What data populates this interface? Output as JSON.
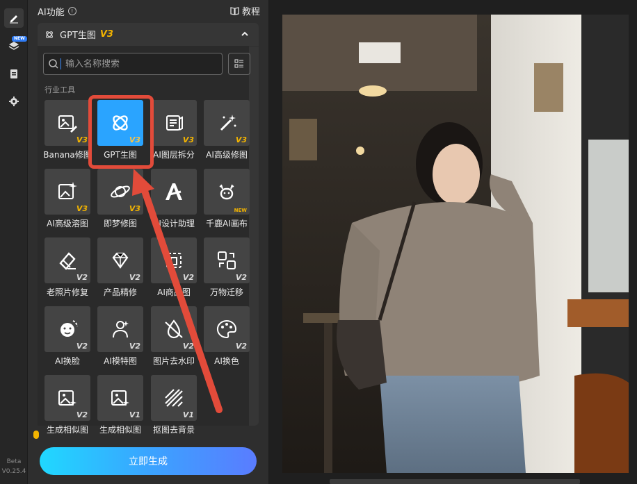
{
  "rail": {
    "new_tag": "NEW",
    "beta": "Beta",
    "version": "V0.25.4"
  },
  "panel": {
    "title": "AI功能",
    "info_symbol": "!",
    "tutorial": "教程",
    "section": {
      "title": "GPT生图",
      "version": "V3"
    },
    "search": {
      "placeholder": "输入名称搜索"
    },
    "category": "行业工具",
    "tools": [
      {
        "label": "Banana修图",
        "version": "V3",
        "icon": "image-edit-icon"
      },
      {
        "label": "GPT生图",
        "version": "V3",
        "icon": "gpt-logo-icon",
        "selected": true
      },
      {
        "label": "AI图层拆分",
        "version": "V3",
        "icon": "layer-split-icon"
      },
      {
        "label": "AI高级修图",
        "version": "V3",
        "icon": "magic-wand-icon"
      },
      {
        "label": "AI高级溶图",
        "version": "V3",
        "icon": "image-sparkle-icon"
      },
      {
        "label": "即梦修图",
        "version": "V3",
        "icon": "planet-icon"
      },
      {
        "label": "AI设计助理",
        "version": "",
        "icon": "ai-assistant-icon"
      },
      {
        "label": "千鹿AI画布",
        "version": "NEW",
        "icon": "deer-icon"
      },
      {
        "label": "老照片修复",
        "version": "V2",
        "icon": "eraser-icon"
      },
      {
        "label": "产品精修",
        "version": "V2",
        "icon": "gem-icon"
      },
      {
        "label": "AI商品图",
        "version": "V2",
        "icon": "product-icon"
      },
      {
        "label": "万物迁移",
        "version": "V2",
        "icon": "transfer-icon"
      },
      {
        "label": "AI换脸",
        "version": "V2",
        "icon": "face-swap-icon"
      },
      {
        "label": "AI模特图",
        "version": "V2",
        "icon": "model-icon"
      },
      {
        "label": "图片去水印",
        "version": "V2",
        "icon": "watermark-remove-icon"
      },
      {
        "label": "AI换色",
        "version": "V2",
        "icon": "palette-icon"
      },
      {
        "label": "生成相似图",
        "version": "V2",
        "icon": "similar-image-icon"
      },
      {
        "label": "生成相似图",
        "version": "V1",
        "icon": "similar-image-icon"
      },
      {
        "label": "抠图去背景",
        "version": "V1",
        "icon": "cutout-icon"
      }
    ],
    "generate_button": "立即生成"
  },
  "colors": {
    "accent": "#2aa4ff",
    "version_gold": "#f3b400",
    "highlight": "#e24b3a"
  }
}
